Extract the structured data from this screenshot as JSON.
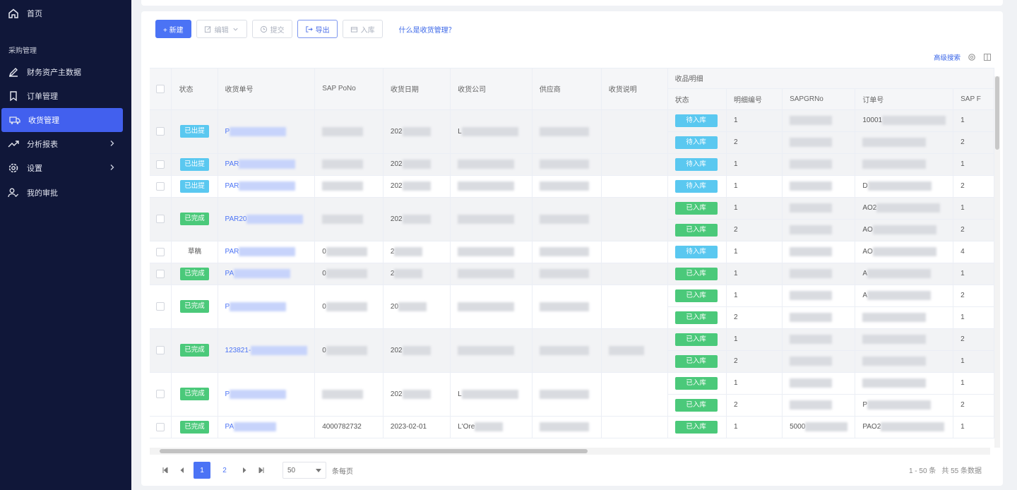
{
  "sidebar": {
    "home": "首页",
    "section": "采购管理",
    "items": [
      {
        "label": "财务资产主数据",
        "icon": "pencil-icon"
      },
      {
        "label": "订单管理",
        "icon": "bookmark-icon"
      },
      {
        "label": "收货管理",
        "icon": "truck-icon",
        "active": true
      },
      {
        "label": "分析报表",
        "icon": "trend-icon",
        "expandable": true
      },
      {
        "label": "设置",
        "icon": "gear-icon",
        "expandable": true
      },
      {
        "label": "我的审批",
        "icon": "user-check-icon"
      }
    ]
  },
  "toolbar": {
    "new": "+ 新建",
    "edit": "编辑",
    "submit": "提交",
    "export": "导出",
    "inbound": "入库",
    "help": "什么是收货管理？"
  },
  "table_tools": {
    "advanced_search": "高级搜索"
  },
  "table": {
    "headers": [
      "状态",
      "收货单号",
      "SAP PoNo",
      "收货日期",
      "收货公司",
      "供应商",
      "收货说明"
    ],
    "group_header": "收品明细",
    "sub_headers": [
      "状态",
      "明细编号",
      "SAPGRNo",
      "订单号",
      "SAP F"
    ],
    "rows": [
      {
        "status": "已出提",
        "status_type": "cyan",
        "no": "P",
        "sap_po": "",
        "date": "202",
        "company": "L",
        "supplier": "",
        "note": "",
        "highlight": true,
        "items": [
          {
            "status": "待入库",
            "type": "cyan",
            "line": "1",
            "grno": "",
            "order": "10001",
            "f": "1"
          },
          {
            "status": "待入库",
            "type": "cyan",
            "line": "2",
            "grno": "",
            "order": "",
            "f": "2"
          }
        ]
      },
      {
        "status": "已出提",
        "status_type": "cyan",
        "no": "PAR",
        "sap_po": "",
        "date": "202",
        "company": "",
        "supplier": "",
        "note": "",
        "highlight": true,
        "items": [
          {
            "status": "待入库",
            "type": "cyan",
            "line": "1",
            "grno": "",
            "order": "",
            "f": "1"
          }
        ]
      },
      {
        "status": "已出提",
        "status_type": "cyan",
        "no": "PAR",
        "sap_po": "",
        "date": "202",
        "company": "",
        "supplier": "",
        "note": "",
        "highlight": false,
        "items": [
          {
            "status": "待入库",
            "type": "cyan",
            "line": "1",
            "grno": "",
            "order": "D",
            "f": "2"
          }
        ]
      },
      {
        "status": "已完成",
        "status_type": "green",
        "no": "PAR20",
        "sap_po": "",
        "date": "202",
        "company": "",
        "supplier": "",
        "note": "",
        "highlight": true,
        "items": [
          {
            "status": "已入库",
            "type": "green",
            "line": "1",
            "grno": "",
            "order": "AO2",
            "f": "1"
          },
          {
            "status": "已入库",
            "type": "green",
            "line": "2",
            "grno": "",
            "order": "AO",
            "f": "2"
          }
        ]
      },
      {
        "status": "草稿",
        "status_type": "plain",
        "no": "PAR",
        "sap_po": "0",
        "date": "2",
        "company": "",
        "supplier": "",
        "note": "",
        "highlight": false,
        "items": [
          {
            "status": "待入库",
            "type": "cyan",
            "line": "1",
            "grno": "",
            "order": "AO",
            "f": "4"
          }
        ]
      },
      {
        "status": "已完成",
        "status_type": "green",
        "no": "PA",
        "sap_po": "0",
        "date": "2",
        "company": "",
        "supplier": "",
        "note": "",
        "highlight": true,
        "items": [
          {
            "status": "已入库",
            "type": "green",
            "line": "1",
            "grno": "",
            "order": "A",
            "f": "1"
          }
        ]
      },
      {
        "status": "已完成",
        "status_type": "green",
        "no": "P",
        "sap_po": "0",
        "date": "20",
        "company": "",
        "supplier": "",
        "note": "",
        "highlight": false,
        "items": [
          {
            "status": "已入库",
            "type": "green",
            "line": "1",
            "grno": "",
            "order": "A",
            "f": "2"
          },
          {
            "status": "已入库",
            "type": "green",
            "line": "2",
            "grno": "",
            "order": "",
            "f": "1"
          }
        ]
      },
      {
        "status": "已完成",
        "status_type": "green",
        "no": "123821-",
        "sap_po": "0",
        "date": "202",
        "company": "",
        "supplier": "",
        "note": "",
        "highlight": true,
        "items": [
          {
            "status": "已入库",
            "type": "green",
            "line": "1",
            "grno": "",
            "order": "",
            "f": "2"
          },
          {
            "status": "已入库",
            "type": "green",
            "line": "2",
            "grno": "",
            "order": "",
            "f": "1"
          }
        ]
      },
      {
        "status": "已完成",
        "status_type": "green",
        "no": "P",
        "sap_po": "",
        "date": "202",
        "company": "L",
        "supplier": "",
        "note": "",
        "highlight": false,
        "items": [
          {
            "status": "已入库",
            "type": "green",
            "line": "1",
            "grno": "",
            "order": "",
            "f": "1"
          },
          {
            "status": "已入库",
            "type": "green",
            "line": "2",
            "grno": "",
            "order": "P",
            "f": "2"
          }
        ]
      },
      {
        "status": "已完成",
        "status_type": "green",
        "no": "PA",
        "sap_po": "4000782732",
        "date": "2023-02-01",
        "company": "L'Ore",
        "supplier": "",
        "note": "",
        "highlight": false,
        "items": [
          {
            "status": "已入库",
            "type": "green",
            "line": "1",
            "grno": "5000",
            "order": "PAO2",
            "f": "1"
          }
        ]
      }
    ]
  },
  "pagination": {
    "pages": [
      "1",
      "2"
    ],
    "current": "1",
    "page_size": "50",
    "per_page_label": "条每页",
    "range": "1 - 50 条",
    "total": "共 55 条数据"
  }
}
